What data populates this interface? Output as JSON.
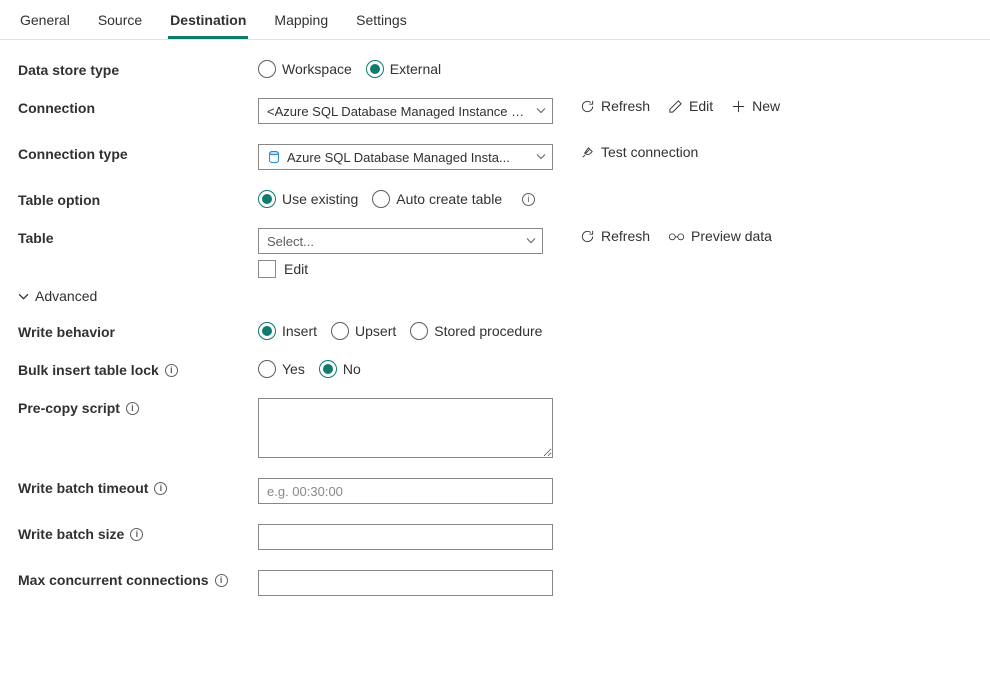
{
  "tabs": {
    "general": "General",
    "source": "Source",
    "destination": "Destination",
    "mapping": "Mapping",
    "settings": "Settings"
  },
  "labels": {
    "dataStoreType": "Data store type",
    "connection": "Connection",
    "connectionType": "Connection type",
    "tableOption": "Table option",
    "table": "Table",
    "writeBehavior": "Write behavior",
    "bulkInsertTableLock": "Bulk insert table lock",
    "preCopyScript": "Pre-copy script",
    "writeBatchTimeout": "Write batch timeout",
    "writeBatchSize": "Write batch size",
    "maxConcurrentConnections": "Max concurrent connections",
    "advanced": "Advanced",
    "edit": "Edit"
  },
  "dataStoreType": {
    "workspace": "Workspace",
    "external": "External"
  },
  "connection": {
    "selected": "<Azure SQL Database Managed Instance connection>"
  },
  "connectionType": {
    "selected": "Azure SQL Database Managed Insta..."
  },
  "tableOption": {
    "useExisting": "Use existing",
    "autoCreate": "Auto create table"
  },
  "table": {
    "placeholder": "Select..."
  },
  "writeBehavior": {
    "insert": "Insert",
    "upsert": "Upsert",
    "storedProcedure": "Stored procedure"
  },
  "bulkLock": {
    "yes": "Yes",
    "no": "No"
  },
  "writeBatchTimeout": {
    "placeholder": "e.g. 00:30:00"
  },
  "actions": {
    "refresh": "Refresh",
    "edit": "Edit",
    "new": "New",
    "testConnection": "Test connection",
    "previewData": "Preview data"
  }
}
